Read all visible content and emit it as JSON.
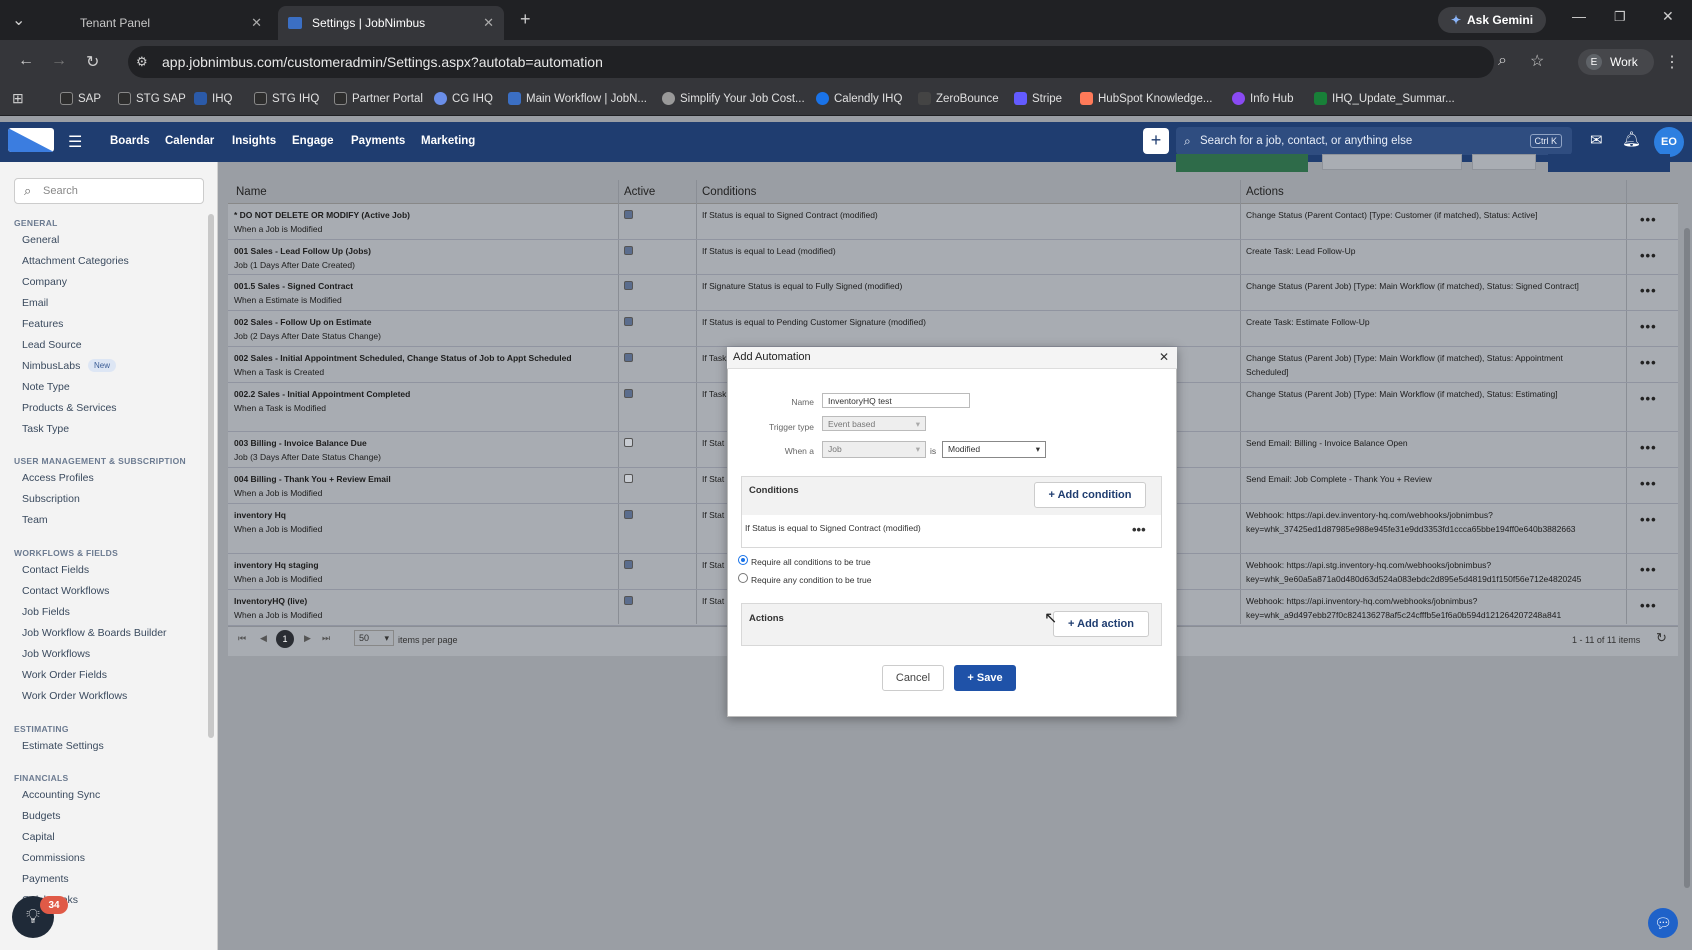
{
  "browser": {
    "tabs": [
      {
        "title": "Tenant Panel",
        "active": false
      },
      {
        "title": "Settings | JobNimbus",
        "active": true
      }
    ],
    "url": "app.jobnimbus.com/customeradmin/Settings.aspx?autotab=automation",
    "ask_gemini": "Ask Gemini",
    "profile": "Work",
    "profile_initial": "E",
    "bookmarks": [
      "SAP",
      "STG SAP",
      "IHQ",
      "STG IHQ",
      "Partner Portal",
      "CG IHQ",
      "Main Workflow | JobN...",
      "Simplify Your Job Cost...",
      "Calendly IHQ",
      "ZeroBounce",
      "Stripe",
      "HubSpot Knowledge...",
      "Info Hub",
      "IHQ_Update_Summar..."
    ]
  },
  "app": {
    "nav": [
      "Boards",
      "Calendar",
      "Insights",
      "Engage",
      "Payments",
      "Marketing"
    ],
    "search_placeholder": "Search for a job, contact, or anything else",
    "shortcut": "Ctrl K",
    "avatar": "EO",
    "accent": "#1f3d70"
  },
  "sidebar": {
    "search_placeholder": "Search",
    "sections": [
      {
        "title": "GENERAL",
        "items": [
          "General",
          "Attachment Categories",
          "Company",
          "Email",
          "Features",
          "Lead Source",
          "NimbusLabs",
          "Note Type",
          "Products & Services",
          "Task Type"
        ]
      },
      {
        "title": "USER MANAGEMENT & SUBSCRIPTION",
        "items": [
          "Access Profiles",
          "Subscription",
          "Team"
        ]
      },
      {
        "title": "WORKFLOWS & FIELDS",
        "items": [
          "Contact Fields",
          "Contact Workflows",
          "Job Fields",
          "Job Workflow & Boards Builder",
          "Job Workflows",
          "Work Order Fields",
          "Work Order Workflows"
        ]
      },
      {
        "title": "ESTIMATING",
        "items": [
          "Estimate Settings"
        ]
      },
      {
        "title": "FINANCIALS",
        "items": [
          "Accounting Sync",
          "Budgets",
          "Capital",
          "Commissions",
          "Payments",
          "QuickBooks"
        ]
      }
    ],
    "new_badge": "New",
    "help_count": "34"
  },
  "grid": {
    "columns": [
      "Name",
      "Active",
      "Conditions",
      "Actions"
    ],
    "rows": [
      {
        "name": "* DO NOT DELETE OR MODIFY (Active Job)",
        "sub": "When a Job is Modified",
        "active": true,
        "cond": "If Status is equal to Signed Contract (modified)",
        "action": "Change Status (Parent Contact) [Type: Customer (if matched), Status: Active]",
        "action2": ""
      },
      {
        "name": "001 Sales - Lead Follow Up (Jobs)",
        "sub": "Job (1 Days After Date Created)",
        "active": true,
        "cond": "If Status is equal to Lead (modified)",
        "action": "Create Task: Lead Follow-Up",
        "action2": ""
      },
      {
        "name": "001.5 Sales - Signed Contract",
        "sub": "When a Estimate is Modified",
        "active": true,
        "cond": "If Signature Status is equal to Fully Signed (modified)",
        "action": "Change Status (Parent Job) [Type: Main Workflow (if matched), Status: Signed Contract]",
        "action2": ""
      },
      {
        "name": "002 Sales - Follow Up on Estimate",
        "sub": "Job (2 Days After Date Status Change)",
        "active": true,
        "cond": "If Status is equal to Pending Customer Signature (modified)",
        "action": "Create Task: Estimate Follow-Up",
        "action2": ""
      },
      {
        "name": "002 Sales - Initial Appointment Scheduled, Change Status of Job to Appt Scheduled",
        "sub": "When a Task is Created",
        "active": true,
        "cond": "If Task",
        "action": "Change Status (Parent Job) [Type: Main Workflow (if matched), Status: Appointment",
        "action2": "Scheduled]"
      },
      {
        "name": "002.2 Sales - Initial Appointment Completed",
        "sub": "When a Task is Modified",
        "active": true,
        "cond": "If Task",
        "action": "Change Status (Parent Job) [Type: Main Workflow (if matched), Status: Estimating]",
        "action2": ""
      },
      {
        "name": "003 Billing - Invoice Balance Due",
        "sub": "Job (3 Days After Date Status Change)",
        "active": false,
        "cond": "If Stat",
        "action": "Send Email: Billing - Invoice Balance Open",
        "action2": ""
      },
      {
        "name": "004 Billing - Thank You + Review Email",
        "sub": "When a Job is Modified",
        "active": false,
        "cond": "If Stat",
        "action": "Send Email: Job Complete - Thank You + Review",
        "action2": ""
      },
      {
        "name": "inventory Hq",
        "sub": "When a Job is Modified",
        "active": true,
        "cond": "If Stat",
        "action": "Webhook: https://api.dev.inventory-hq.com/webhooks/jobnimbus?",
        "action2": "key=whk_37425ed1d87985e988e945fe31e9dd3353fd1ccca65bbe194ff0e640b3882663"
      },
      {
        "name": "inventory Hq staging",
        "sub": "When a Job is Modified",
        "active": true,
        "cond": "If Stat",
        "action": "Webhook: https://api.stg.inventory-hq.com/webhooks/jobnimbus?",
        "action2": "key=whk_9e60a5a871a0d480d63d524a083ebdc2d895e5d4819d1f150f56e712e4820245"
      },
      {
        "name": "InventoryHQ (live)",
        "sub": "When a Job is Modified",
        "active": true,
        "cond": "If Stat",
        "action": "Webhook: https://api.inventory-hq.com/webhooks/jobnimbus?",
        "action2": "key=whk_a9d497ebb27f0c824136278af5c24cfffb5e1f6a0b594d121264207248a841"
      }
    ],
    "page": "1",
    "page_size": "50",
    "items_per_page": "items per page",
    "summary": "1 - 11 of 11 items"
  },
  "modal": {
    "title": "Add Automation",
    "name_label": "Name",
    "name_value": "InventoryHQ test",
    "trigger_label": "Trigger type",
    "trigger_value": "Event based",
    "when_label": "When a",
    "when_value": "Job",
    "is_label": "is",
    "is_value": "Modified",
    "conditions_title": "Conditions",
    "add_condition": "+ Add condition",
    "condition_text": "If Status is equal to Signed Contract (modified)",
    "radio_all": "Require all conditions to be true",
    "radio_any": "Require any condition to be true",
    "actions_title": "Actions",
    "add_action": "+ Add action",
    "cancel": "Cancel",
    "save": "+ Save"
  }
}
